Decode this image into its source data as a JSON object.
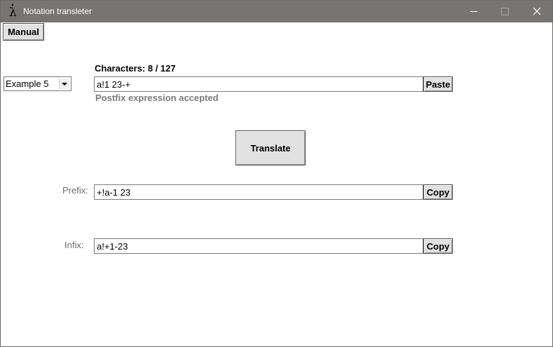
{
  "window": {
    "title": "Notation transleter",
    "app_icon": "lambda-icon",
    "controls": [
      "minimize-icon",
      "maximize-icon",
      "close-icon"
    ]
  },
  "toolbar": {
    "manual_label": "Manual"
  },
  "example_select": {
    "selected": "Example 5"
  },
  "input": {
    "char_count": "Characters: 8 / 127",
    "value": "a!1 23-+",
    "paste_label": "Paste",
    "status": "Postfix expression accepted"
  },
  "translate_label": "Translate",
  "prefix": {
    "label": "Prefix:",
    "value": "+!a-1 23",
    "copy_label": "Copy"
  },
  "infix": {
    "label": "Infix:",
    "value": "a!+1-23",
    "copy_label": "Copy"
  }
}
